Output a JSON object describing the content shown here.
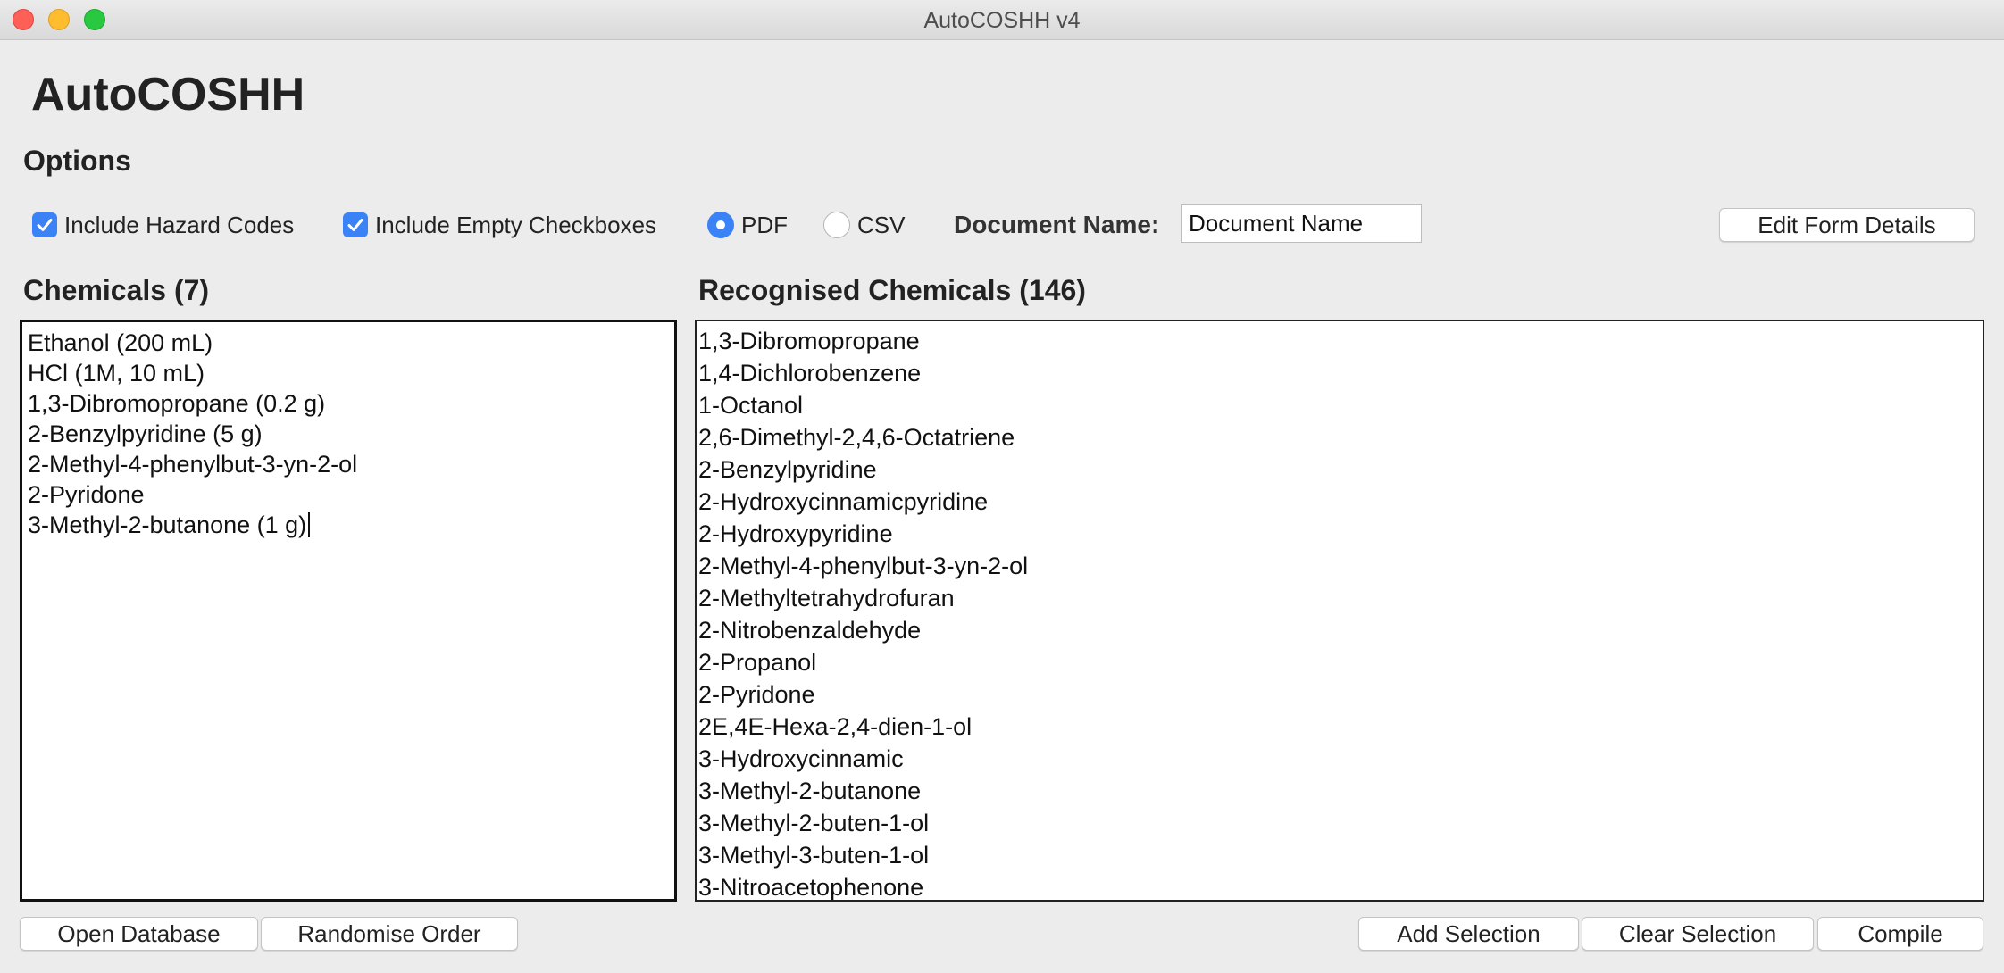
{
  "window": {
    "title": "AutoCOSHH v4"
  },
  "app": {
    "heading": "AutoCOSHH"
  },
  "options": {
    "heading": "Options",
    "include_hazard_codes": {
      "label": "Include Hazard Codes",
      "checked": true
    },
    "include_empty_checkboxes": {
      "label": "Include Empty Checkboxes",
      "checked": true
    },
    "format_pdf": {
      "label": "PDF",
      "selected": true
    },
    "format_csv": {
      "label": "CSV",
      "selected": false
    },
    "document_name_label": "Document Name:",
    "document_name_value": "Document Name",
    "edit_form_details_label": "Edit Form Details"
  },
  "chemicals": {
    "heading": "Chemicals (7)",
    "lines": [
      "Ethanol (200 mL)",
      "HCl (1M, 10 mL)",
      "1,3-Dibromopropane (0.2 g)",
      "2-Benzylpyridine (5 g)",
      "2-Methyl-4-phenylbut-3-yn-2-ol",
      "2-Pyridone",
      "3-Methyl-2-butanone (1 g)"
    ]
  },
  "recognised": {
    "heading": "Recognised Chemicals (146)",
    "items": [
      "1,3-Dibromopropane",
      "1,4-Dichlorobenzene",
      "1-Octanol",
      "2,6-Dimethyl-2,4,6-Octatriene",
      "2-Benzylpyridine",
      "2-Hydroxycinnamicpyridine",
      "2-Hydroxypyridine",
      "2-Methyl-4-phenylbut-3-yn-2-ol",
      "2-Methyltetrahydrofuran",
      "2-Nitrobenzaldehyde",
      "2-Propanol",
      "2-Pyridone",
      "2E,4E-Hexa-2,4-dien-1-ol",
      "3-Hydroxycinnamic",
      "3-Methyl-2-butanone",
      "3-Methyl-2-buten-1-ol",
      "3-Methyl-3-buten-1-ol",
      "3-Nitroacetophenone"
    ]
  },
  "buttons": {
    "open_database": "Open Database",
    "randomise_order": "Randomise Order",
    "add_selection": "Add Selection",
    "clear_selection": "Clear Selection",
    "compile": "Compile"
  },
  "colors": {
    "accent": "#3b82f6",
    "window_bg": "#ececec"
  }
}
